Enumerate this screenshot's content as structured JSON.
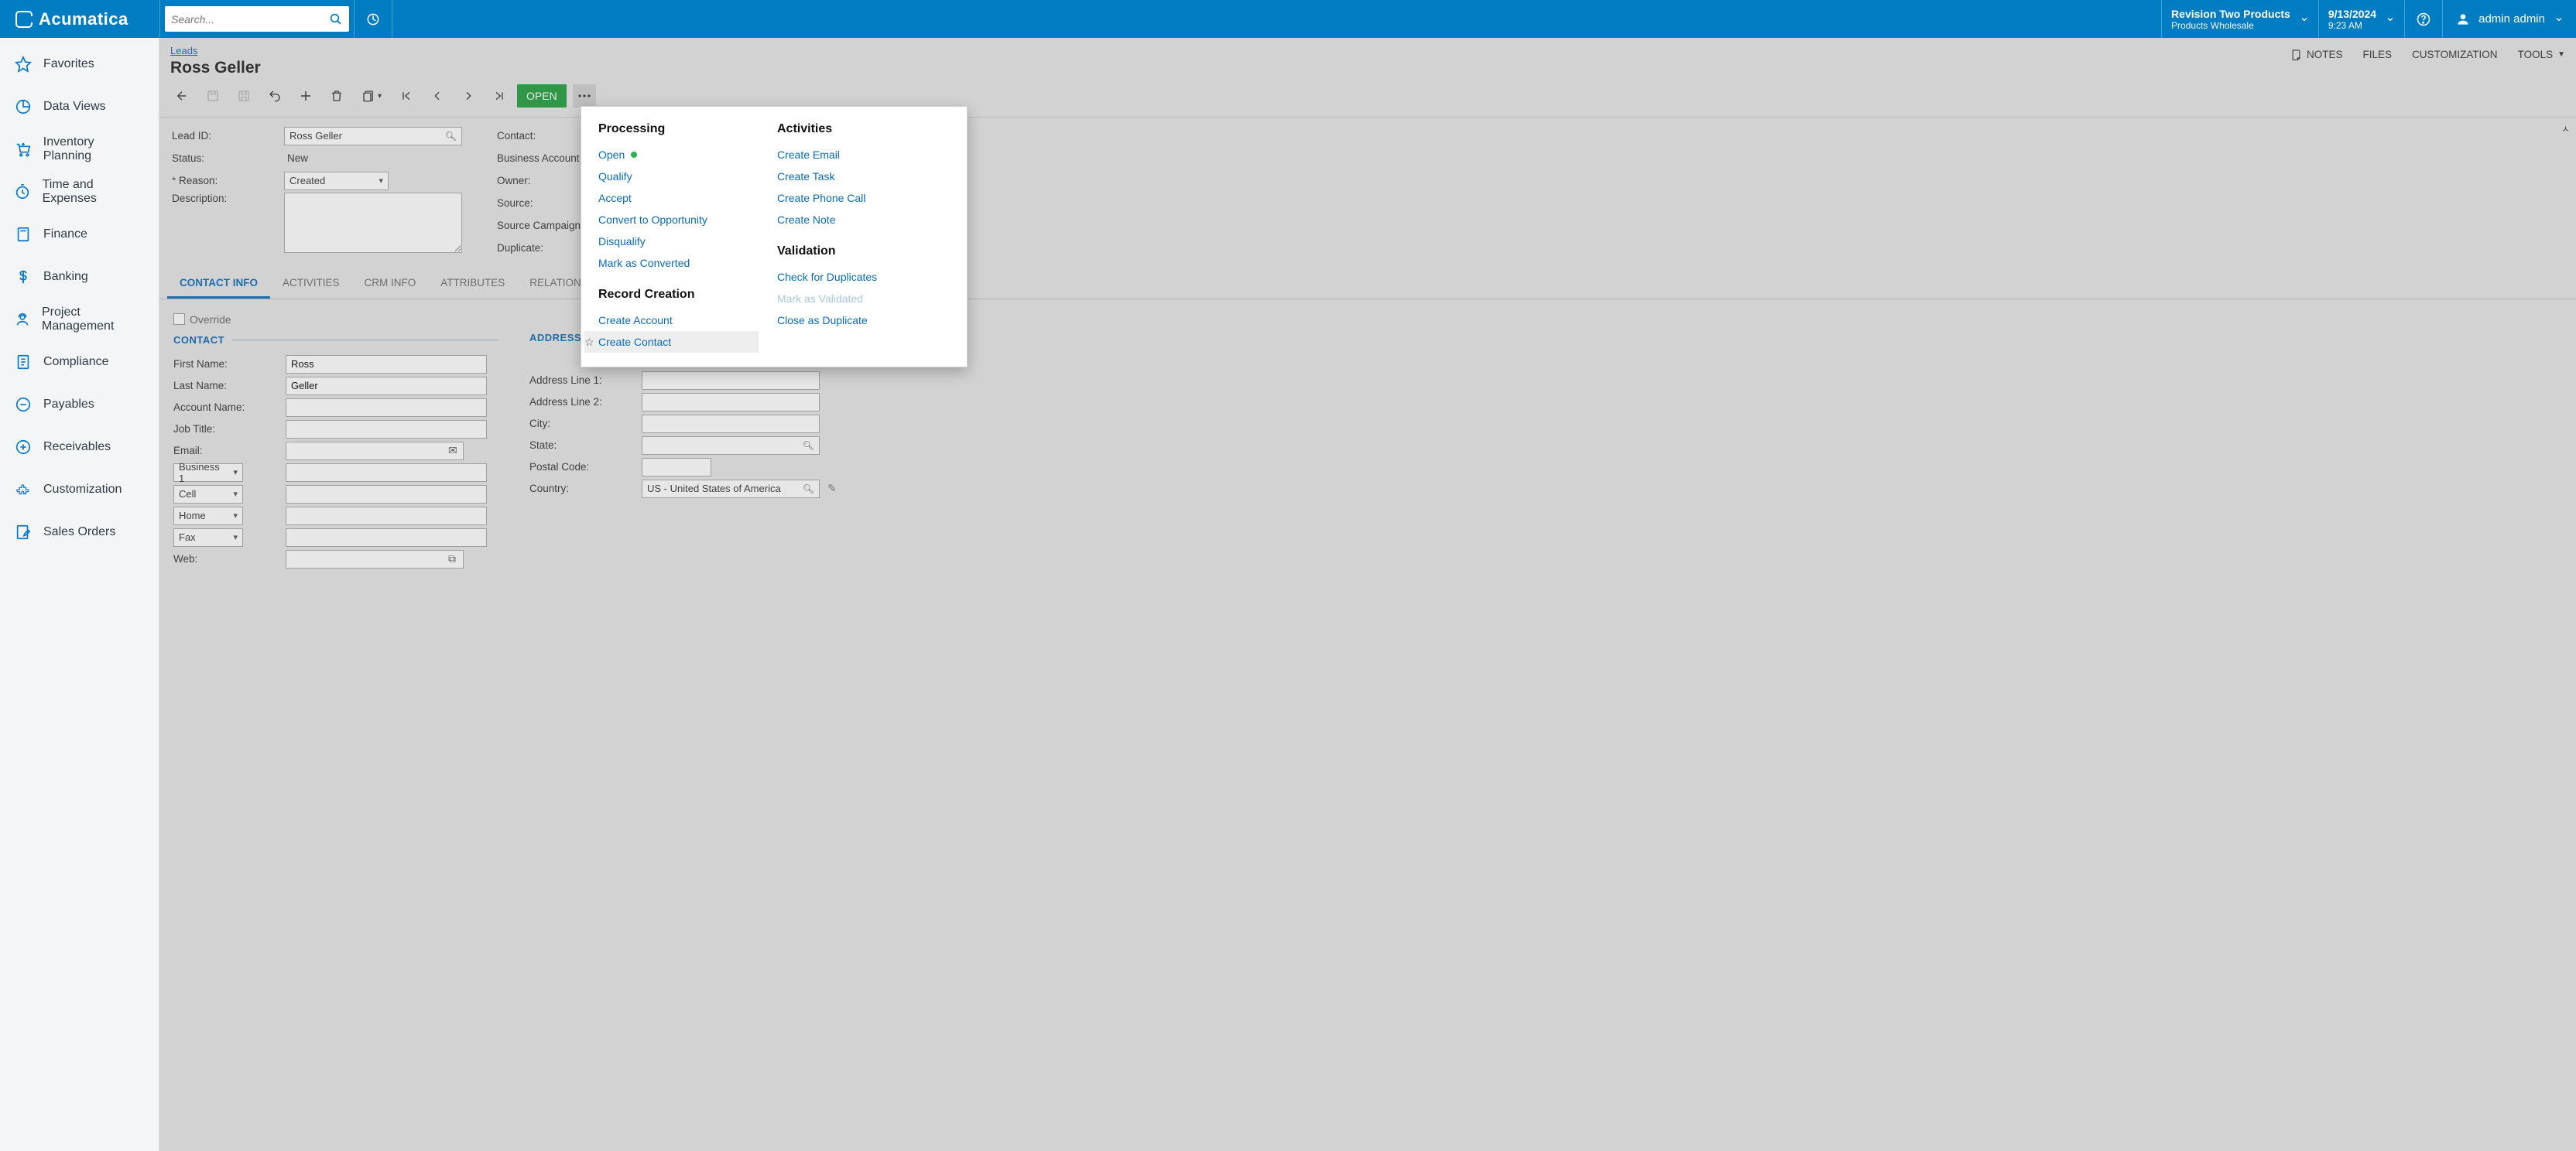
{
  "brand": "Acumatica",
  "search": {
    "placeholder": "Search..."
  },
  "topbar": {
    "tenant_title": "Revision Two Products",
    "tenant_sub": "Products Wholesale",
    "date": "9/13/2024",
    "time": "9:23 AM",
    "user": "admin admin"
  },
  "nav": {
    "items": [
      "Favorites",
      "Data Views",
      "Inventory Planning",
      "Time and Expenses",
      "Finance",
      "Banking",
      "Project Management",
      "Compliance",
      "Payables",
      "Receivables",
      "Customization",
      "Sales Orders"
    ]
  },
  "header": {
    "breadcrumb": "Leads",
    "title": "Ross Geller",
    "tools": {
      "notes": "NOTES",
      "files": "FILES",
      "customization": "CUSTOMIZATION",
      "tools": "TOOLS"
    },
    "open_badge": "OPEN"
  },
  "form": {
    "labels": {
      "lead_id": "Lead ID:",
      "status": "Status:",
      "reason": "Reason:",
      "description": "Description:",
      "contact": "Contact:",
      "business_account": "Business Account:",
      "owner": "Owner:",
      "source": "Source:",
      "source_campaign": "Source Campaign:",
      "duplicate": "Duplicate:"
    },
    "values": {
      "lead_id": "Ross Geller",
      "status": "New",
      "reason": "Created"
    }
  },
  "tabs": [
    "CONTACT INFO",
    "ACTIVITIES",
    "CRM INFO",
    "ATTRIBUTES",
    "RELATIONS"
  ],
  "contact_section": {
    "override": "Override",
    "contact_header": "CONTACT",
    "address_header": "ADDRESS",
    "labels": {
      "first_name": "First Name:",
      "last_name": "Last Name:",
      "account_name": "Account Name:",
      "job_title": "Job Title:",
      "email": "Email:",
      "web": "Web:",
      "addr1": "Address Line 1:",
      "addr2": "Address Line 2:",
      "city": "City:",
      "state": "State:",
      "postal": "Postal Code:",
      "country": "Country:"
    },
    "values": {
      "first_name": "Ross",
      "last_name": "Geller",
      "country": "US - United States of America"
    },
    "phone_types": [
      "Business 1",
      "Cell",
      "Home",
      "Fax"
    ]
  },
  "popup": {
    "processing_header": "Processing",
    "processing": [
      "Open",
      "Qualify",
      "Accept",
      "Convert to Opportunity",
      "Disqualify",
      "Mark as Converted"
    ],
    "record_header": "Record Creation",
    "record": [
      "Create Account",
      "Create Contact"
    ],
    "activities_header": "Activities",
    "activities": [
      "Create Email",
      "Create Task",
      "Create Phone Call",
      "Create Note"
    ],
    "validation_header": "Validation",
    "validation": [
      "Check for Duplicates",
      "Mark as Validated",
      "Close as Duplicate"
    ]
  }
}
